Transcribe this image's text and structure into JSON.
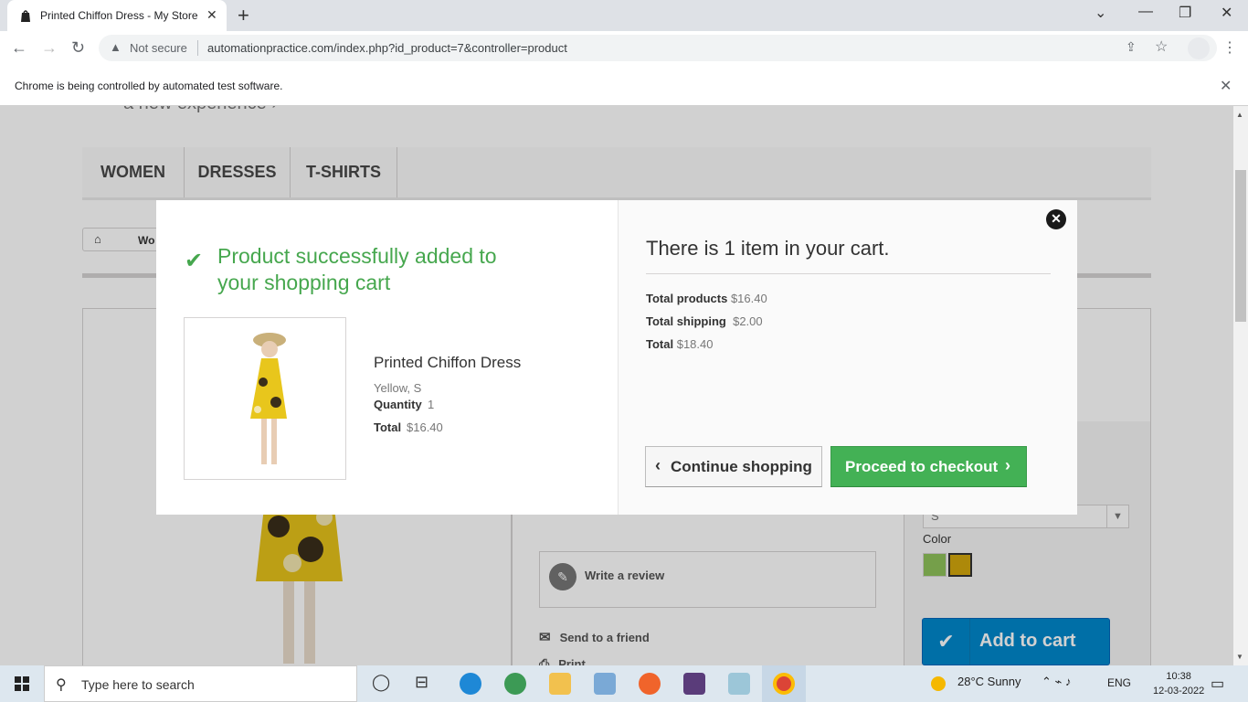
{
  "browser": {
    "tab_title": "Printed Chiffon Dress - My Store",
    "not_secure": "Not secure",
    "url": "automationpractice.com/index.php?id_product=7&controller=product",
    "infobar_message": "Chrome is being controlled by automated test software."
  },
  "page": {
    "tagline": "a new experience",
    "nav": [
      "WOMEN",
      "DRESSES",
      "T-SHIRTS"
    ],
    "breadcrumb_item": "Wo",
    "write_review": "Write a review",
    "send_friend": "Send to a friend",
    "print": "Print",
    "size_value": "S",
    "color_label": "Color",
    "colors": [
      "#8fc35b",
      "#d4a80d"
    ],
    "add_to_cart": "Add to cart"
  },
  "modal": {
    "success_title": "Product successfully added to your shopping cart",
    "product_name": "Printed Chiffon Dress",
    "product_attributes": "Yellow, S",
    "quantity_label": "Quantity",
    "quantity_value": "1",
    "total_label": "Total",
    "total_value": "$16.40",
    "cart_count_text": "There is 1 item in your cart.",
    "summary": {
      "products_label": "Total products",
      "products_value": "$16.40",
      "shipping_label": "Total shipping",
      "shipping_value": "$2.00",
      "total_label": "Total",
      "total_value": "$18.40"
    },
    "continue_label": "Continue shopping",
    "checkout_label": "Proceed to checkout"
  },
  "taskbar": {
    "search_placeholder": "Type here to search",
    "weather": "28°C  Sunny",
    "language": "ENG",
    "time": "10:38",
    "date": "12-03-2022"
  },
  "colors": {
    "success_green": "#46a74e",
    "checkout_green": "#43b155",
    "add_to_cart_blue": "#0088cc"
  }
}
